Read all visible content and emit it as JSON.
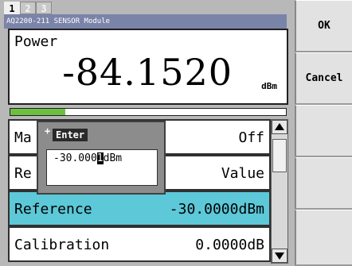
{
  "tabs": [
    {
      "label": "1",
      "active": true
    },
    {
      "label": "2",
      "active": false
    },
    {
      "label": "3",
      "active": false
    }
  ],
  "module_header": "AQ2200-211 SENSOR Module",
  "power": {
    "label": "Power",
    "value": "-84.1520",
    "unit": "dBm",
    "bar_level_fraction": 0.2
  },
  "menu": [
    {
      "label": "Ma",
      "value": "Off",
      "selected": false
    },
    {
      "label": "Re",
      "value": "Value",
      "selected": false
    },
    {
      "label": "Reference",
      "value": "-30.0000dBm",
      "selected": true
    },
    {
      "label": "Calibration",
      "value": "0.0000dB",
      "selected": false
    }
  ],
  "dialog": {
    "plus_mark": "+",
    "title": "Enter",
    "value_before_cursor": "-30.000",
    "cursor_char": "1",
    "value_after_cursor": "dBm"
  },
  "softkeys": [
    "OK",
    "Cancel",
    "",
    "",
    ""
  ],
  "colors": {
    "header_bg": "#7a84a8",
    "selected_row": "#5cc8d8",
    "level_bar": "#6cc040"
  }
}
